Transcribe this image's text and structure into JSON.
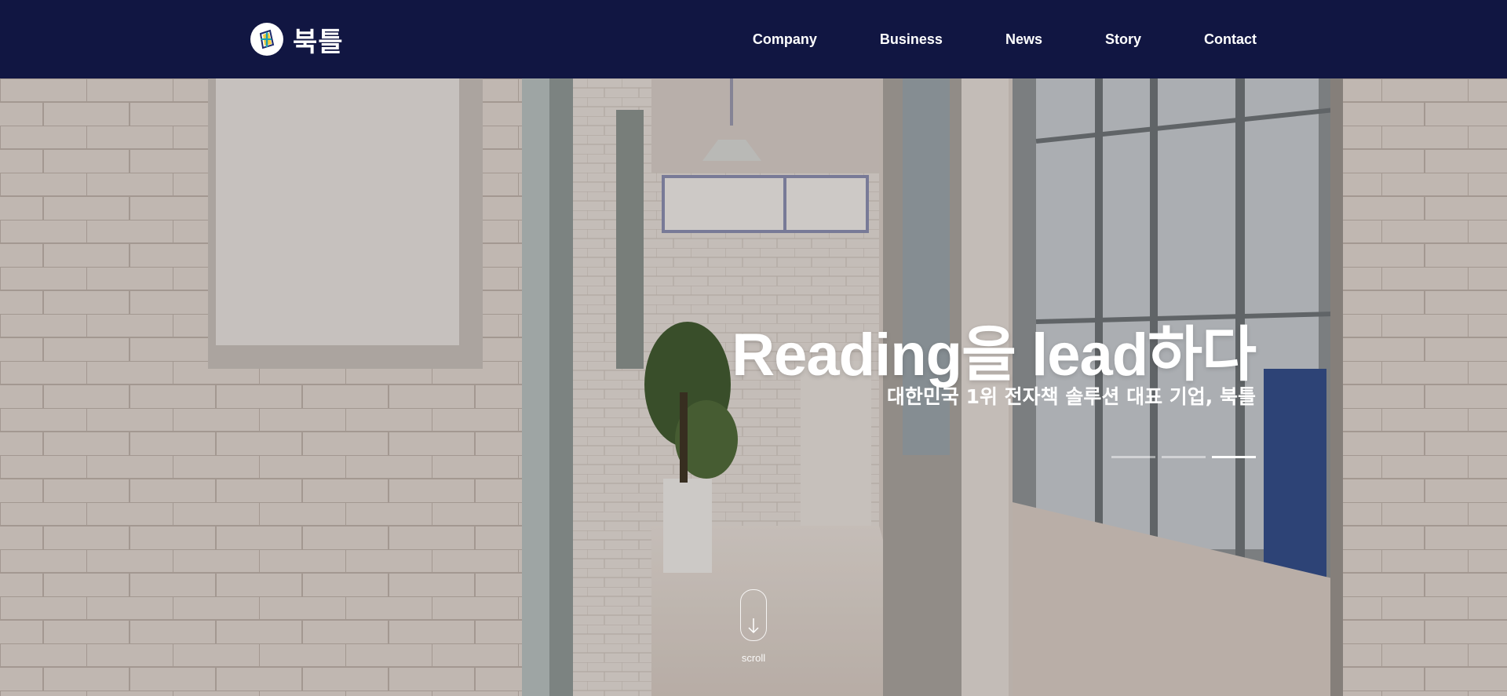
{
  "header": {
    "logo_text": "북틀",
    "nav": [
      "Company",
      "Business",
      "News",
      "Story",
      "Contact"
    ]
  },
  "hero": {
    "title": "Reading을 lead하다",
    "subtitle": "대한민국 1위 전자책 솔루션 대표 기업, 북틀",
    "slides": {
      "count": 3,
      "active_index": 2
    },
    "scroll_label": "scroll"
  },
  "colors": {
    "header_bg": "#111642",
    "text": "#ffffff",
    "logo_yellow": "#f2c417",
    "logo_teal": "#1d9fb0",
    "logo_navy": "#1d2a6b"
  }
}
